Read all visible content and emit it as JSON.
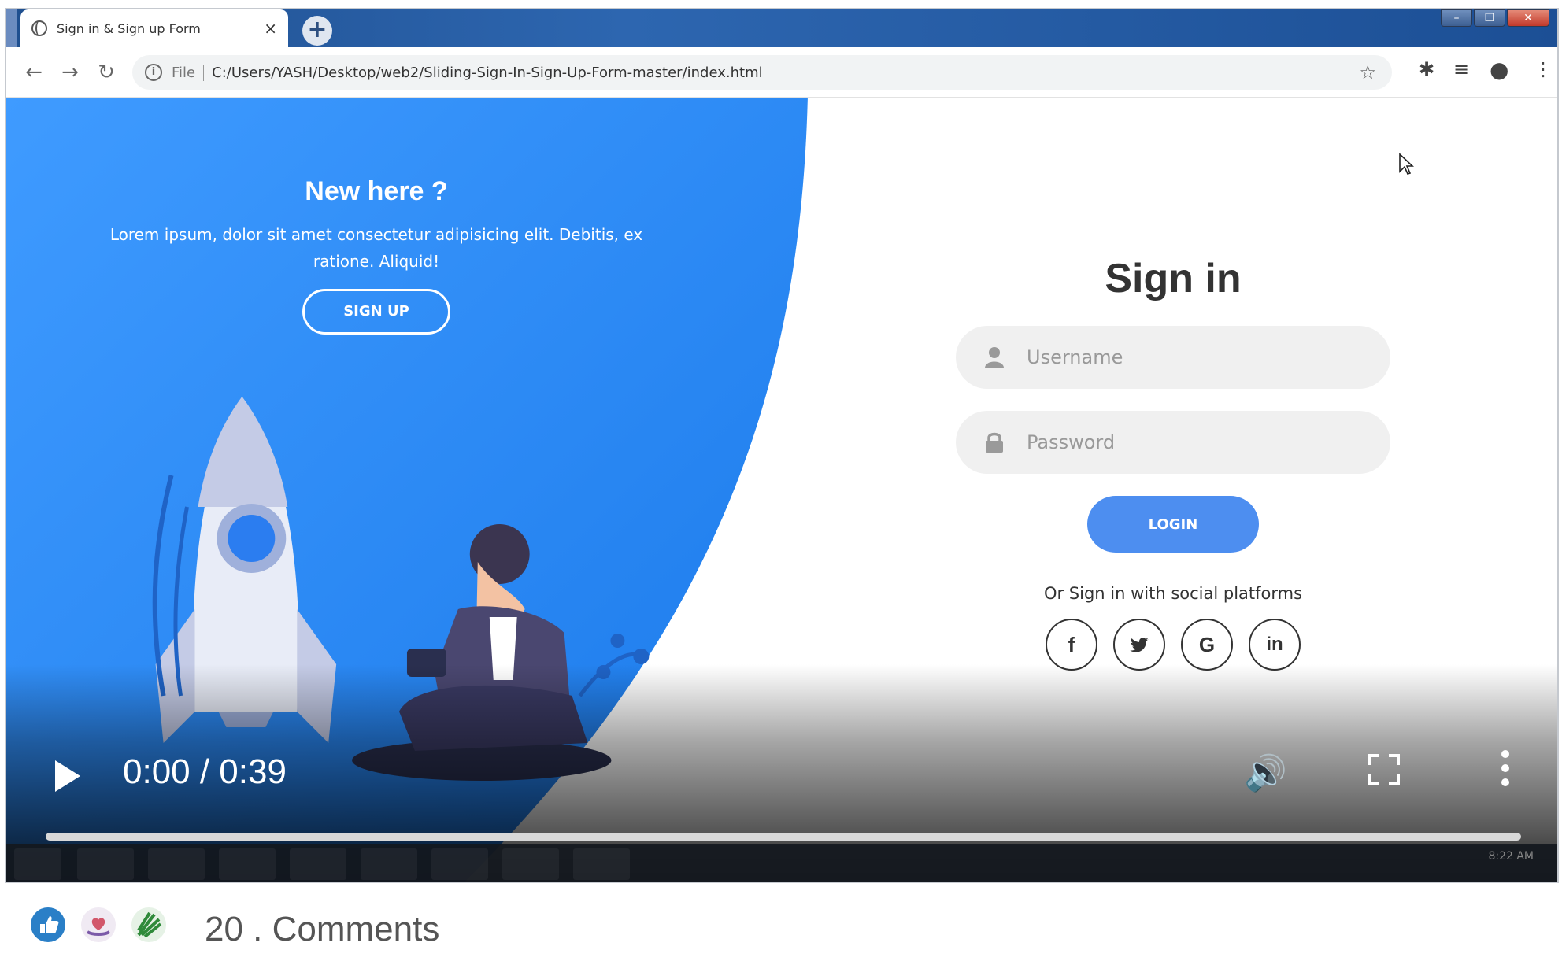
{
  "browser": {
    "tab_title": "Sign in & Sign up Form",
    "close_glyph": "×",
    "new_tab_glyph": "+",
    "url_scheme": "File",
    "url": "C:/Users/YASH/Desktop/web2/Sliding-Sign-In-Sign-Up-Form-master/index.html",
    "window_controls": [
      "–",
      "❐",
      "✕"
    ]
  },
  "page": {
    "panel_title": "New here ?",
    "panel_desc": "Lorem ipsum, dolor sit amet consectetur adipisicing elit. Debitis, ex ratione. Aliquid!",
    "signup_label": "SIGN UP",
    "signin_title": "Sign in",
    "username_placeholder": "Username",
    "password_placeholder": "Password",
    "login_label": "LOGIN",
    "social_text": "Or Sign in with social platforms",
    "social": [
      {
        "name": "facebook-icon",
        "glyph": "f"
      },
      {
        "name": "twitter-icon",
        "glyph": "🐦"
      },
      {
        "name": "google-icon",
        "glyph": "G"
      },
      {
        "name": "linkedin-icon",
        "glyph": "in"
      }
    ],
    "colors": {
      "primary": "#2b8ef5",
      "button": "#4d8ef0"
    }
  },
  "video": {
    "time": "0:00 / 0:39",
    "progress": 0.0,
    "clock_time": "8:22 AM",
    "clock_date": ""
  },
  "footer": {
    "comments": "20 . Comments"
  }
}
